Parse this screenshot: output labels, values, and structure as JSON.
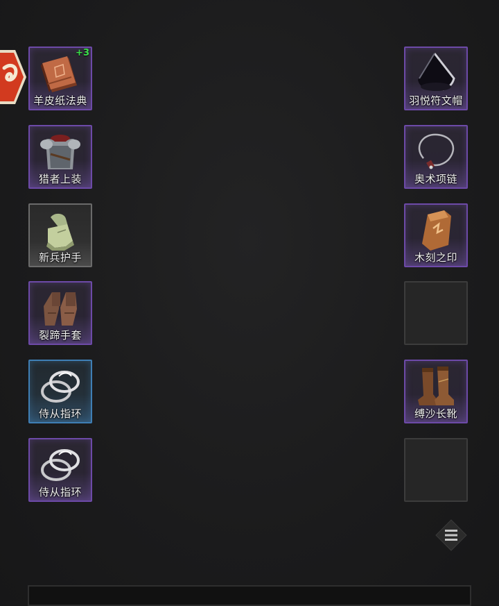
{
  "left_slots": [
    {
      "label": "羊皮纸法典",
      "rarity": "purple",
      "icon": "book-icon",
      "enhance": "+3"
    },
    {
      "label": "猎者上装",
      "rarity": "purple",
      "icon": "chest-armor-icon"
    },
    {
      "label": "新兵护手",
      "rarity": "gray",
      "icon": "cloth-gloves-icon"
    },
    {
      "label": "裂蹄手套",
      "rarity": "purple",
      "icon": "leather-gloves-icon"
    },
    {
      "label": "侍从指环",
      "rarity": "blue",
      "icon": "ring-icon"
    },
    {
      "label": "侍从指环",
      "rarity": "purple",
      "icon": "ring-icon"
    }
  ],
  "right_slots": [
    {
      "label": "羽悦符文帽",
      "rarity": "purple",
      "icon": "hat-icon"
    },
    {
      "label": "奥术项链",
      "rarity": "purple",
      "icon": "necklace-icon"
    },
    {
      "label": "木刻之印",
      "rarity": "purple",
      "icon": "wood-seal-icon"
    },
    {
      "label": "",
      "rarity": "empty",
      "icon": ""
    },
    {
      "label": "缚沙长靴",
      "rarity": "purple",
      "icon": "boots-icon"
    },
    {
      "label": "",
      "rarity": "empty",
      "icon": ""
    }
  ],
  "menu_button": {
    "icon": "menu-icon"
  },
  "side_badge": {
    "icon": "character-badge-icon"
  }
}
